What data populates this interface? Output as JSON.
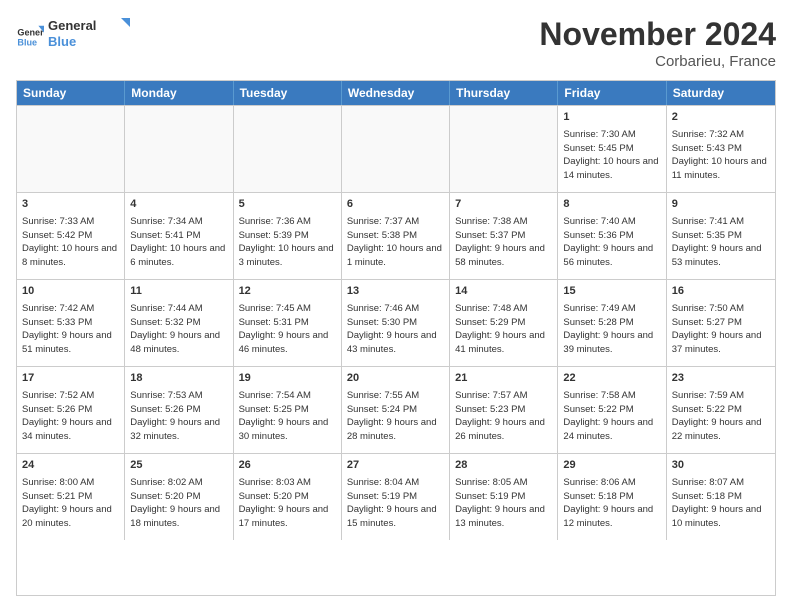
{
  "logo": {
    "line1": "General",
    "line2": "Blue"
  },
  "title": "November 2024",
  "location": "Corbarieu, France",
  "days": [
    "Sunday",
    "Monday",
    "Tuesday",
    "Wednesday",
    "Thursday",
    "Friday",
    "Saturday"
  ],
  "rows": [
    [
      {
        "day": "",
        "info": "",
        "empty": true
      },
      {
        "day": "",
        "info": "",
        "empty": true
      },
      {
        "day": "",
        "info": "",
        "empty": true
      },
      {
        "day": "",
        "info": "",
        "empty": true
      },
      {
        "day": "",
        "info": "",
        "empty": true
      },
      {
        "day": "1",
        "info": "Sunrise: 7:30 AM\nSunset: 5:45 PM\nDaylight: 10 hours and 14 minutes.",
        "empty": false
      },
      {
        "day": "2",
        "info": "Sunrise: 7:32 AM\nSunset: 5:43 PM\nDaylight: 10 hours and 11 minutes.",
        "empty": false
      }
    ],
    [
      {
        "day": "3",
        "info": "Sunrise: 7:33 AM\nSunset: 5:42 PM\nDaylight: 10 hours and 8 minutes.",
        "empty": false
      },
      {
        "day": "4",
        "info": "Sunrise: 7:34 AM\nSunset: 5:41 PM\nDaylight: 10 hours and 6 minutes.",
        "empty": false
      },
      {
        "day": "5",
        "info": "Sunrise: 7:36 AM\nSunset: 5:39 PM\nDaylight: 10 hours and 3 minutes.",
        "empty": false
      },
      {
        "day": "6",
        "info": "Sunrise: 7:37 AM\nSunset: 5:38 PM\nDaylight: 10 hours and 1 minute.",
        "empty": false
      },
      {
        "day": "7",
        "info": "Sunrise: 7:38 AM\nSunset: 5:37 PM\nDaylight: 9 hours and 58 minutes.",
        "empty": false
      },
      {
        "day": "8",
        "info": "Sunrise: 7:40 AM\nSunset: 5:36 PM\nDaylight: 9 hours and 56 minutes.",
        "empty": false
      },
      {
        "day": "9",
        "info": "Sunrise: 7:41 AM\nSunset: 5:35 PM\nDaylight: 9 hours and 53 minutes.",
        "empty": false
      }
    ],
    [
      {
        "day": "10",
        "info": "Sunrise: 7:42 AM\nSunset: 5:33 PM\nDaylight: 9 hours and 51 minutes.",
        "empty": false
      },
      {
        "day": "11",
        "info": "Sunrise: 7:44 AM\nSunset: 5:32 PM\nDaylight: 9 hours and 48 minutes.",
        "empty": false
      },
      {
        "day": "12",
        "info": "Sunrise: 7:45 AM\nSunset: 5:31 PM\nDaylight: 9 hours and 46 minutes.",
        "empty": false
      },
      {
        "day": "13",
        "info": "Sunrise: 7:46 AM\nSunset: 5:30 PM\nDaylight: 9 hours and 43 minutes.",
        "empty": false
      },
      {
        "day": "14",
        "info": "Sunrise: 7:48 AM\nSunset: 5:29 PM\nDaylight: 9 hours and 41 minutes.",
        "empty": false
      },
      {
        "day": "15",
        "info": "Sunrise: 7:49 AM\nSunset: 5:28 PM\nDaylight: 9 hours and 39 minutes.",
        "empty": false
      },
      {
        "day": "16",
        "info": "Sunrise: 7:50 AM\nSunset: 5:27 PM\nDaylight: 9 hours and 37 minutes.",
        "empty": false
      }
    ],
    [
      {
        "day": "17",
        "info": "Sunrise: 7:52 AM\nSunset: 5:26 PM\nDaylight: 9 hours and 34 minutes.",
        "empty": false
      },
      {
        "day": "18",
        "info": "Sunrise: 7:53 AM\nSunset: 5:26 PM\nDaylight: 9 hours and 32 minutes.",
        "empty": false
      },
      {
        "day": "19",
        "info": "Sunrise: 7:54 AM\nSunset: 5:25 PM\nDaylight: 9 hours and 30 minutes.",
        "empty": false
      },
      {
        "day": "20",
        "info": "Sunrise: 7:55 AM\nSunset: 5:24 PM\nDaylight: 9 hours and 28 minutes.",
        "empty": false
      },
      {
        "day": "21",
        "info": "Sunrise: 7:57 AM\nSunset: 5:23 PM\nDaylight: 9 hours and 26 minutes.",
        "empty": false
      },
      {
        "day": "22",
        "info": "Sunrise: 7:58 AM\nSunset: 5:22 PM\nDaylight: 9 hours and 24 minutes.",
        "empty": false
      },
      {
        "day": "23",
        "info": "Sunrise: 7:59 AM\nSunset: 5:22 PM\nDaylight: 9 hours and 22 minutes.",
        "empty": false
      }
    ],
    [
      {
        "day": "24",
        "info": "Sunrise: 8:00 AM\nSunset: 5:21 PM\nDaylight: 9 hours and 20 minutes.",
        "empty": false
      },
      {
        "day": "25",
        "info": "Sunrise: 8:02 AM\nSunset: 5:20 PM\nDaylight: 9 hours and 18 minutes.",
        "empty": false
      },
      {
        "day": "26",
        "info": "Sunrise: 8:03 AM\nSunset: 5:20 PM\nDaylight: 9 hours and 17 minutes.",
        "empty": false
      },
      {
        "day": "27",
        "info": "Sunrise: 8:04 AM\nSunset: 5:19 PM\nDaylight: 9 hours and 15 minutes.",
        "empty": false
      },
      {
        "day": "28",
        "info": "Sunrise: 8:05 AM\nSunset: 5:19 PM\nDaylight: 9 hours and 13 minutes.",
        "empty": false
      },
      {
        "day": "29",
        "info": "Sunrise: 8:06 AM\nSunset: 5:18 PM\nDaylight: 9 hours and 12 minutes.",
        "empty": false
      },
      {
        "day": "30",
        "info": "Sunrise: 8:07 AM\nSunset: 5:18 PM\nDaylight: 9 hours and 10 minutes.",
        "empty": false
      }
    ]
  ]
}
